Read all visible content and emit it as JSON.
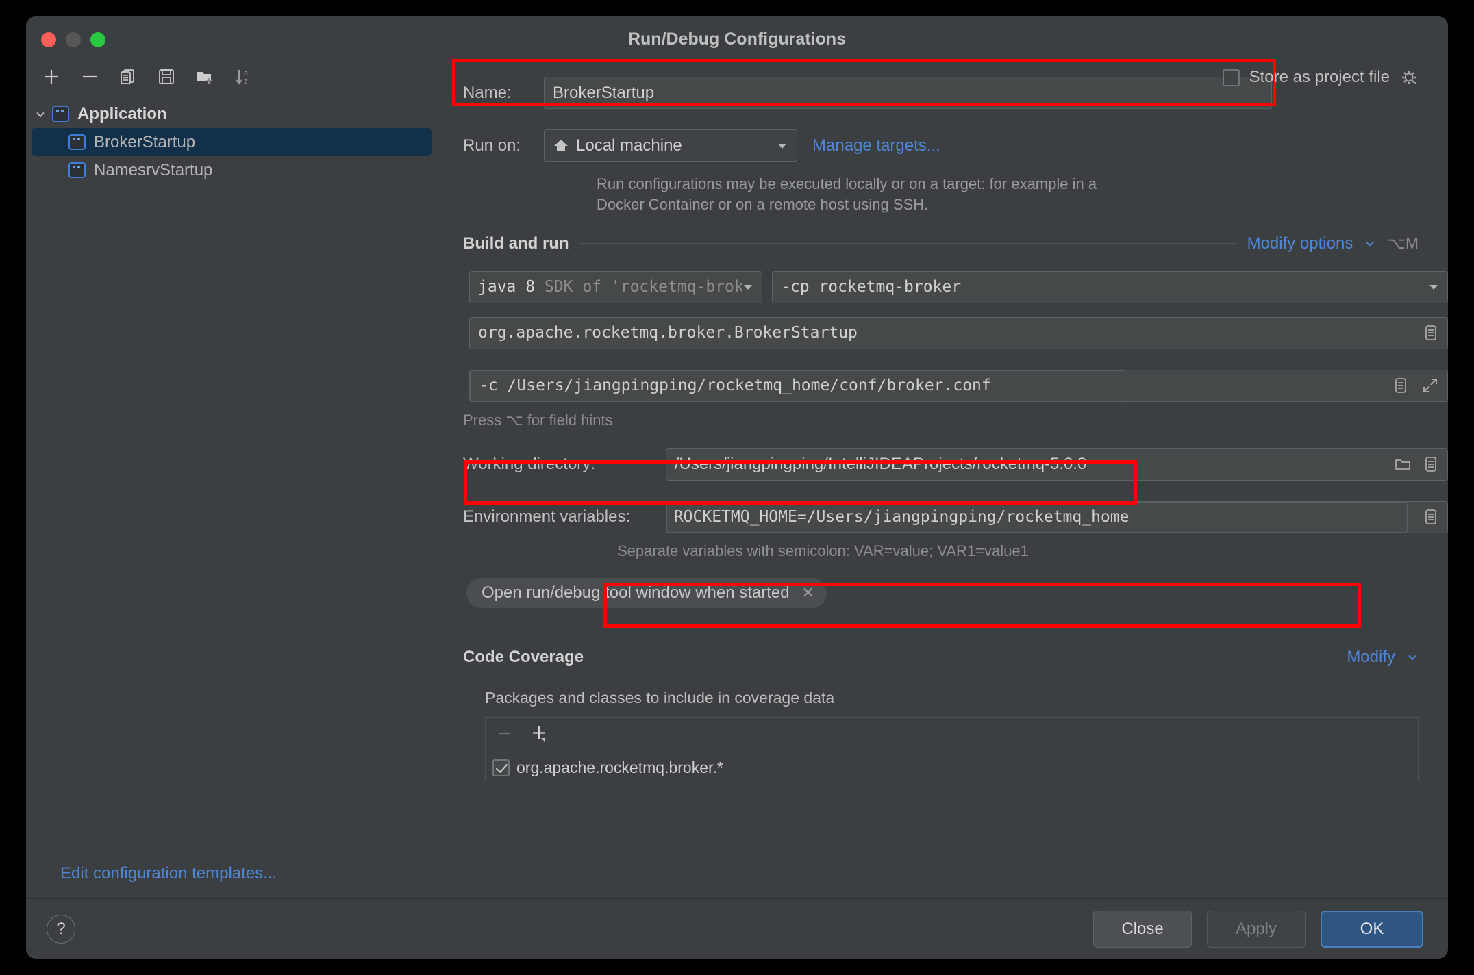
{
  "window": {
    "title": "Run/Debug Configurations",
    "traffic_lights": [
      "close",
      "minimize",
      "maximize"
    ]
  },
  "sidebar": {
    "toolbar": [
      {
        "name": "add-configuration",
        "icon": "plus-icon"
      },
      {
        "name": "remove-configuration",
        "icon": "minus-icon"
      },
      {
        "name": "copy-configuration",
        "icon": "copy-icon"
      },
      {
        "name": "save-configuration",
        "icon": "save-icon"
      },
      {
        "name": "move-into-folder",
        "icon": "new-folder-icon"
      },
      {
        "name": "sort-configurations",
        "icon": "sort-az-icon"
      }
    ],
    "tree": {
      "group_label": "Application",
      "items": [
        {
          "label": "BrokerStartup",
          "selected": true
        },
        {
          "label": "NamesrvStartup",
          "selected": false
        }
      ]
    },
    "edit_templates_link": "Edit configuration templates..."
  },
  "main": {
    "name": {
      "label": "Name:",
      "value": "BrokerStartup",
      "highlighted": true
    },
    "store_as_project_file": {
      "label": "Store as project file",
      "checked": false,
      "gear_icon": "gear-icon"
    },
    "run_on": {
      "label": "Run on:",
      "value": "Local machine",
      "icon": "home-icon",
      "manage_targets_link": "Manage targets...",
      "description": "Run configurations may be executed locally or on a target: for example in a Docker Container or on a remote host using SSH."
    },
    "build_and_run": {
      "title": "Build and run",
      "modify_options_link": "Modify options",
      "shortcut": "⌥M",
      "jdk": {
        "primary": "java 8",
        "secondary": "SDK of 'rocketmq-broker' mo"
      },
      "classpath": "-cp rocketmq-broker",
      "main_class": "org.apache.rocketmq.broker.BrokerStartup",
      "program_arguments": "-c /Users/jiangpingping/rocketmq_home/conf/broker.conf",
      "program_arguments_highlighted": true,
      "field_hint": "Press ⌥ for field hints"
    },
    "working_directory": {
      "label": "Working directory:",
      "value": "/Users/jiangpingping/IntelliJIDEAProjects/rocketmq-5.0.0"
    },
    "environment_variables": {
      "label": "Environment variables:",
      "value": "ROCKETMQ_HOME=/Users/jiangpingping/rocketmq_home",
      "highlighted": true,
      "hint": "Separate variables with semicolon: VAR=value; VAR1=value1"
    },
    "chip": {
      "label": "Open run/debug tool window when started",
      "close_icon": "close-icon"
    },
    "code_coverage": {
      "title": "Code Coverage",
      "modify_link": "Modify",
      "packages_title": "Packages and classes to include in coverage data",
      "toolbar": [
        {
          "name": "remove-package",
          "icon": "minus-icon"
        },
        {
          "name": "add-package",
          "icon": "plus-icon"
        }
      ],
      "items": [
        {
          "label": "org.apache.rocketmq.broker.*",
          "checked": true
        }
      ]
    }
  },
  "bottom_bar": {
    "help_icon": "question-mark-icon",
    "buttons": [
      {
        "label": "Close",
        "style": "normal"
      },
      {
        "label": "Apply",
        "style": "disabled"
      },
      {
        "label": "OK",
        "style": "primary"
      }
    ]
  },
  "colors": {
    "window_bg": "#3c3f41",
    "accent_link": "#4e86d6",
    "highlight_box": "#ff0000",
    "selection_bg": "#123049",
    "primary_button": "#2f5582"
  }
}
